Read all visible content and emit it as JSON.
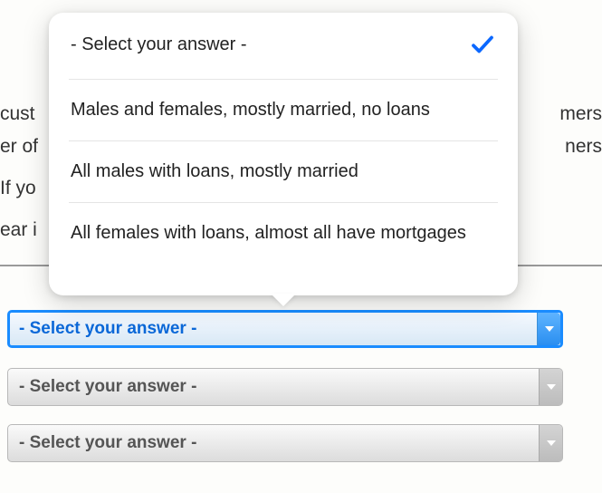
{
  "popover": {
    "options": [
      "- Select your answer -",
      "Males and females, mostly married, no loans",
      "All males with loans, mostly married",
      "All females with loans, almost all have mortgages"
    ],
    "selected_index": 0
  },
  "background_text": {
    "t1_left": "cust",
    "t1_right": "mers",
    "t2_left": "er of",
    "t2_right": "ners",
    "t3_left": "If yo",
    "t4_left": "ear i"
  },
  "dropdowns": [
    {
      "label": "- Select your answer -",
      "active": true
    },
    {
      "label": "- Select your answer -",
      "active": false
    },
    {
      "label": "- Select your answer -",
      "active": false
    }
  ]
}
